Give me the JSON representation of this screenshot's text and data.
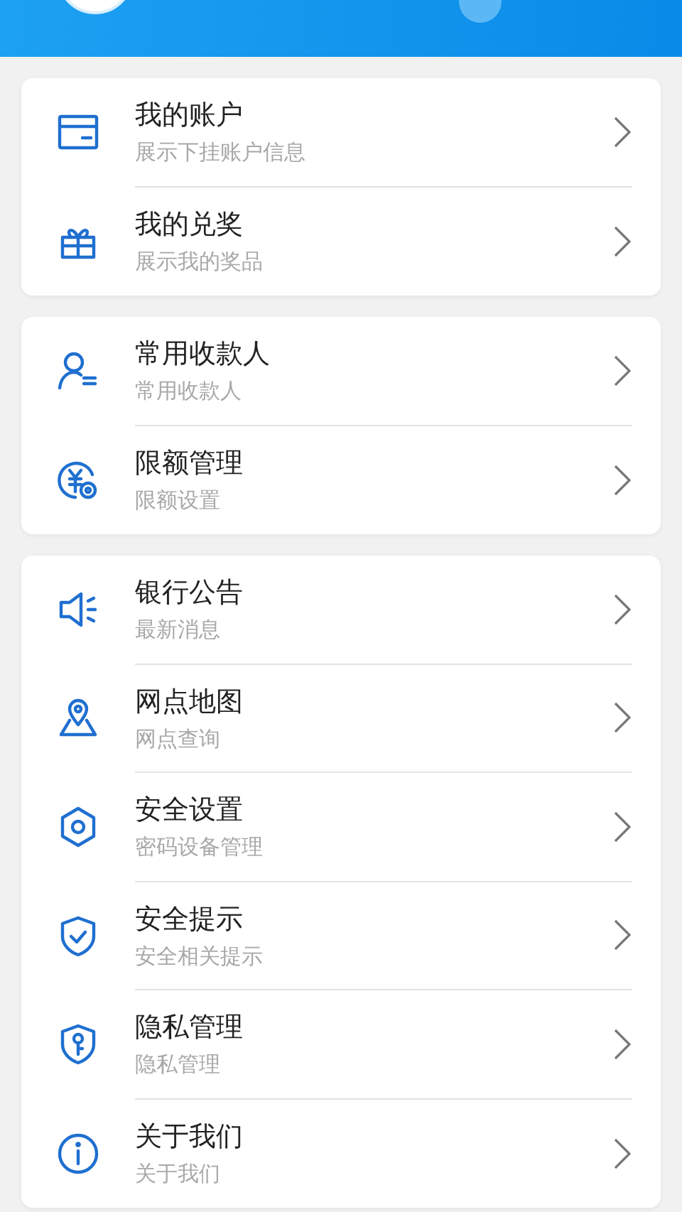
{
  "groups": [
    {
      "items": [
        {
          "title": "我的账户",
          "subtitle": "展示下挂账户信息"
        },
        {
          "title": "我的兑奖",
          "subtitle": "展示我的奖品"
        }
      ]
    },
    {
      "items": [
        {
          "title": "常用收款人",
          "subtitle": "常用收款人"
        },
        {
          "title": "限额管理",
          "subtitle": "限额设置"
        }
      ]
    },
    {
      "items": [
        {
          "title": "银行公告",
          "subtitle": "最新消息"
        },
        {
          "title": "网点地图",
          "subtitle": "网点查询"
        },
        {
          "title": "安全设置",
          "subtitle": "密码设备管理"
        },
        {
          "title": "安全提示",
          "subtitle": "安全相关提示"
        },
        {
          "title": "隐私管理",
          "subtitle": "隐私管理"
        },
        {
          "title": "关于我们",
          "subtitle": "关于我们"
        }
      ]
    }
  ]
}
